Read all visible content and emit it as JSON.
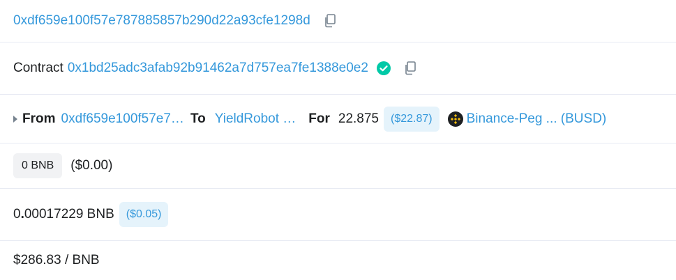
{
  "rows": {
    "address": {
      "value": "0xdf659e100f57e787885857b290d22a93cfe1298d",
      "copy_icon": "copy-icon"
    },
    "contract": {
      "label": "Contract",
      "address": "0x1bd25adc3afab92b91462a7d757ea7fe1388e0e2",
      "verified_icon": "check-circle-icon",
      "copy_icon": "copy-icon"
    },
    "transfer": {
      "from_label": "From",
      "from_value": "0xdf659e100f57e7…",
      "to_label": "To",
      "to_value": "YieldRobot …",
      "for_label": "For",
      "amount": "22.875",
      "usd_value": "($22.87)",
      "token_icon": "binance-token-icon",
      "token_name": "Binance-Peg ... (BUSD)",
      "accent": "#3498db"
    },
    "value": {
      "badge": "0 BNB",
      "usd": "($0.00)"
    },
    "fee": {
      "amount_int": "0",
      "amount_dot": ".",
      "amount_rest": "00017229 BNB",
      "usd_badge": "($0.05)"
    },
    "price": {
      "value": "$286.83 / BNB"
    }
  }
}
